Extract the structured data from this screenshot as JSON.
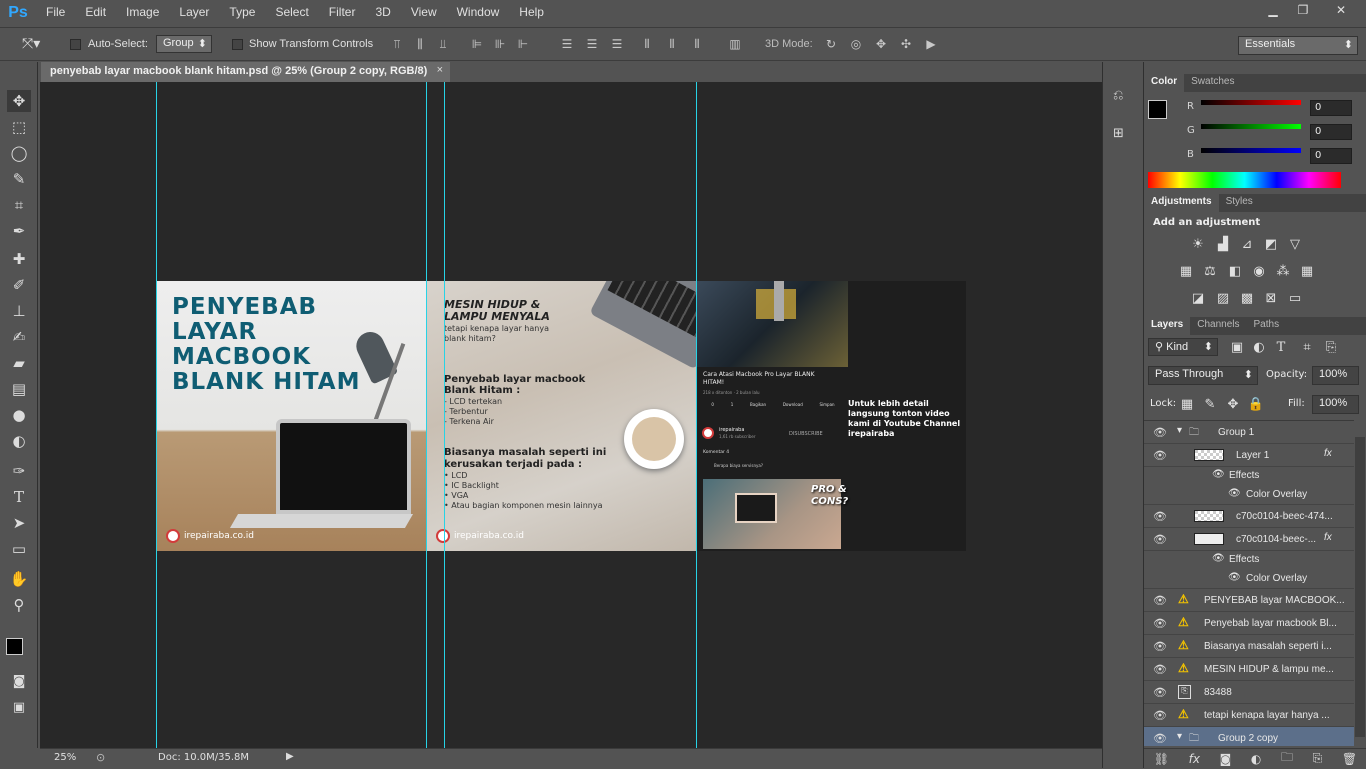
{
  "app": {
    "logo": "Ps"
  },
  "menu": [
    "File",
    "Edit",
    "Image",
    "Layer",
    "Type",
    "Select",
    "Filter",
    "3D",
    "View",
    "Window",
    "Help"
  ],
  "window_controls": {
    "minimize": "▁",
    "restore": "❐",
    "close": "✕"
  },
  "options": {
    "auto_select_label": "Auto-Select:",
    "auto_select_value": "Group",
    "transform_label": "Show Transform Controls",
    "mode3d_label": "3D Mode:",
    "workspace": "Essentials"
  },
  "document_tab": {
    "title": "penyebab layar macbook blank hitam.psd @ 25% (Group 2 copy, RGB/8)",
    "close": "×"
  },
  "banner": {
    "panel1": {
      "headline": [
        "PENYEBAB",
        "LAYAR",
        "MACBOOK",
        "BLANK HITAM"
      ],
      "logo_text": "irepairaba.co.id"
    },
    "panel2": {
      "title": [
        "MESIN HIDUP &",
        "LAMPU MENYALA"
      ],
      "subtitle": [
        "tetapi kenapa layar hanya",
        "blank hitam?"
      ],
      "causes_title": [
        "Penyebab layar macbook",
        "Blank Hitam :"
      ],
      "causes": [
        "- LCD tertekan",
        "- Terbentur",
        "- Terkena Air"
      ],
      "damage_title": [
        "Biasanya masalah seperti ini",
        "kerusakan terjadi pada :"
      ],
      "damage": [
        "• LCD",
        "• IC Backlight",
        "• VGA",
        "• Atau bagian komponen mesin lainnya"
      ],
      "logo_text": "irepairaba.co.id"
    },
    "panel3": {
      "video_title": [
        "Cara Atasi Macbook Pro Layar BLANK",
        "HITAM!"
      ],
      "video_meta": "218 x ditonton · 2 bulan lalu",
      "actions": [
        "0",
        "1",
        "Bagikan",
        "Download",
        "Simpan"
      ],
      "channel": "irepairaba",
      "channel_subs": "1,61 rb subscriber",
      "subscribe": "DISUBSCRIBE",
      "comments_label": "Komentar  4",
      "comment": "Berapa biaya servisnya?",
      "thumb_text": [
        "PRO &",
        "CONS?"
      ],
      "side_text": [
        "Untuk lebih detail",
        "langsung tonton video",
        "kami di Youtube Channel",
        "irepairaba"
      ]
    }
  },
  "status": {
    "zoom": "25%",
    "doc": "Doc: 10.0M/35.8M"
  },
  "color_panel": {
    "tabs": [
      "Color",
      "Swatches"
    ],
    "channels": [
      {
        "label": "R",
        "value": "0"
      },
      {
        "label": "G",
        "value": "0"
      },
      {
        "label": "B",
        "value": "0"
      }
    ],
    "colors": {
      "r": "#ff0000",
      "g": "#00ff00",
      "b": "#0000ff"
    }
  },
  "adjustments_panel": {
    "tabs": [
      "Adjustments",
      "Styles"
    ],
    "title": "Add an adjustment"
  },
  "layers_panel": {
    "tabs": [
      "Layers",
      "Channels",
      "Paths"
    ],
    "filter_kind": "Kind",
    "blend_mode": "Pass Through",
    "opacity_label": "Opacity:",
    "opacity_value": "100%",
    "lock_label": "Lock:",
    "fill_label": "Fill:",
    "fill_value": "100%",
    "layers": [
      {
        "name": "Group 1",
        "kind": "group"
      },
      {
        "name": "Layer 1",
        "kind": "layer-fx"
      },
      {
        "name": "Effects",
        "kind": "effects"
      },
      {
        "name": "Color Overlay",
        "kind": "effect-item"
      },
      {
        "name": "c70c0104-beec-474...",
        "kind": "layer"
      },
      {
        "name": "c70c0104-beec-...",
        "kind": "layer-fx"
      },
      {
        "name": "Effects",
        "kind": "effects"
      },
      {
        "name": "Color Overlay",
        "kind": "effect-item"
      },
      {
        "name": "PENYEBAB layar MACBOOK...",
        "kind": "text-warn"
      },
      {
        "name": "Penyebab layar macbook Bl...",
        "kind": "text-warn"
      },
      {
        "name": "Biasanya masalah seperti i...",
        "kind": "text-warn"
      },
      {
        "name": "MESIN HIDUP & lampu me...",
        "kind": "text-warn"
      },
      {
        "name": "83488",
        "kind": "smart"
      },
      {
        "name": "tetapi kenapa layar hanya ...",
        "kind": "text-warn"
      },
      {
        "name": "Group 2 copy",
        "kind": "group-selected"
      }
    ]
  }
}
